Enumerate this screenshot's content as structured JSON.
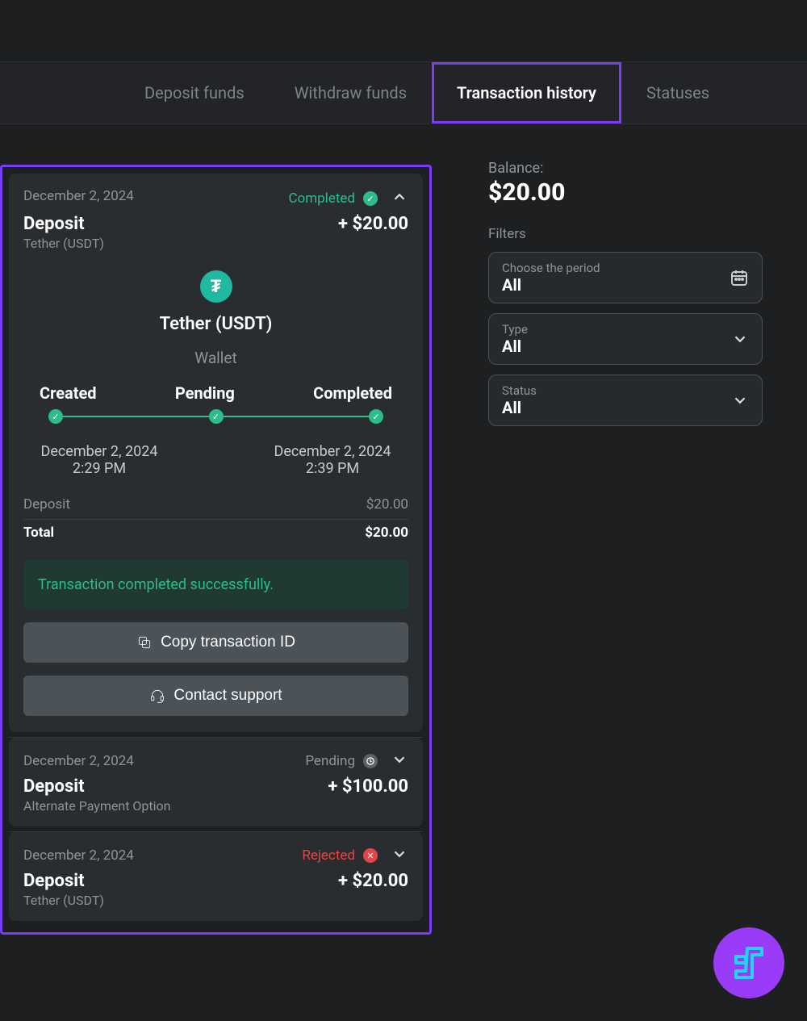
{
  "tabs": {
    "deposit": "Deposit funds",
    "withdraw": "Withdraw funds",
    "history": "Transaction history",
    "statuses": "Statuses"
  },
  "balance": {
    "label": "Balance:",
    "value": "$20.00"
  },
  "filters": {
    "label": "Filters",
    "period": {
      "label": "Choose the period",
      "value": "All"
    },
    "type": {
      "label": "Type",
      "value": "All"
    },
    "status": {
      "label": "Status",
      "value": "All"
    }
  },
  "tx": [
    {
      "date": "December 2, 2024",
      "status": "Completed",
      "type": "Deposit",
      "subtitle": "Tether (USDT)",
      "amount": "+ $20.00",
      "coin_name": "Tether (USDT)",
      "wallet_label": "Wallet",
      "steps": {
        "created": "Created",
        "pending": "Pending",
        "completed": "Completed"
      },
      "time_created": "December 2, 2024 2:29 PM",
      "time_completed": "December 2, 2024 2:39 PM",
      "breakdown_label": "Deposit",
      "breakdown_value": "$20.00",
      "total_label": "Total",
      "total_value": "$20.00",
      "success_msg": "Transaction completed successfully.",
      "copy_btn": "Copy transaction ID",
      "support_btn": "Contact support"
    },
    {
      "date": "December 2, 2024",
      "status": "Pending",
      "type": "Deposit",
      "subtitle": "Alternate Payment Option",
      "amount": "+ $100.00"
    },
    {
      "date": "December 2, 2024",
      "status": "Rejected",
      "type": "Deposit",
      "subtitle": "Tether (USDT)",
      "amount": "+ $20.00"
    }
  ]
}
